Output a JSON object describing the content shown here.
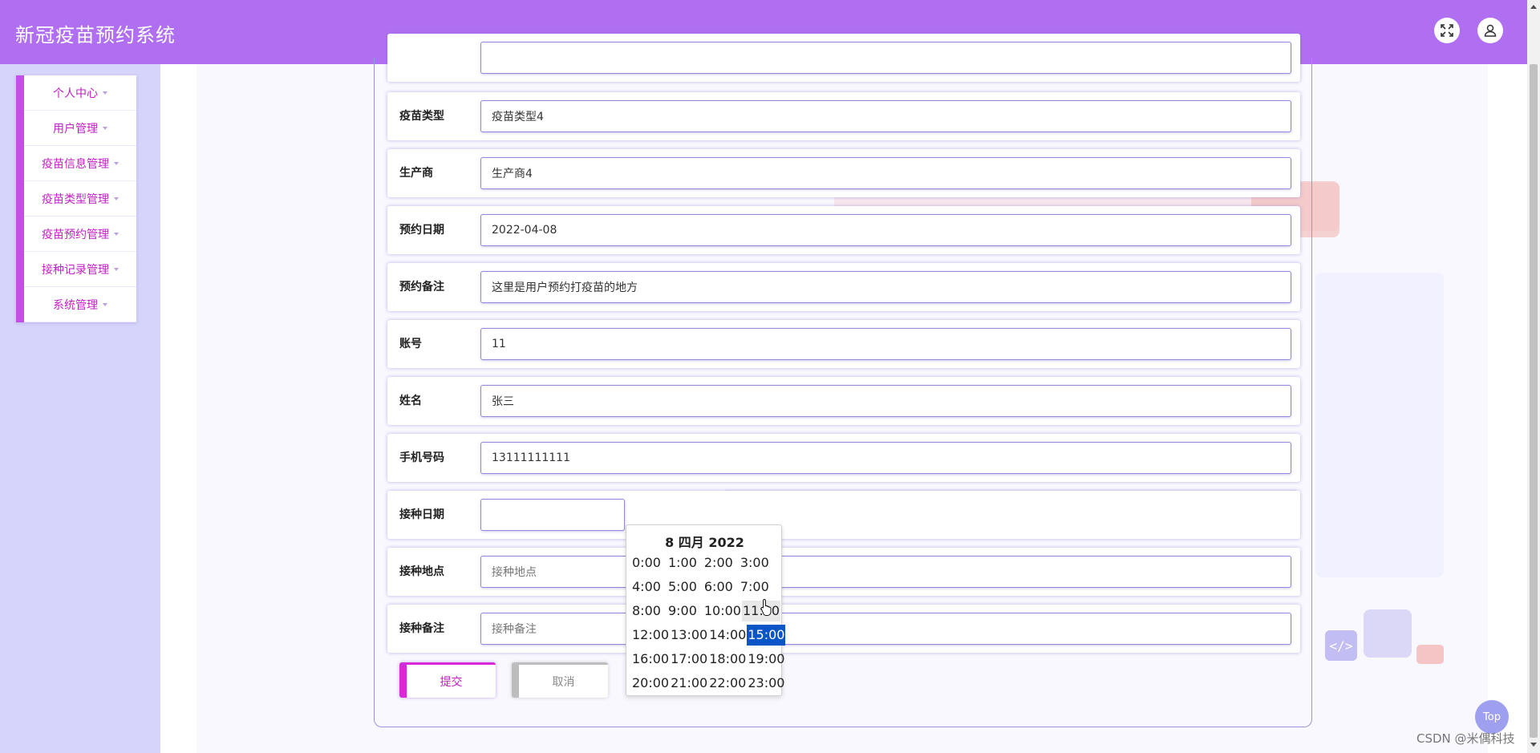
{
  "app": {
    "title": "新冠疫苗预约系统"
  },
  "header": {
    "fullscreen_icon": "fullscreen-icon",
    "user_icon": "user-icon"
  },
  "sidebar": {
    "items": [
      {
        "label": "个人中心"
      },
      {
        "label": "用户管理"
      },
      {
        "label": "疫苗信息管理"
      },
      {
        "label": "疫苗类型管理"
      },
      {
        "label": "疫苗预约管理"
      },
      {
        "label": "接种记录管理"
      },
      {
        "label": "系统管理"
      }
    ]
  },
  "form": {
    "fields": [
      {
        "label": "疫苗类型",
        "value": "疫苗类型4"
      },
      {
        "label": "生产商",
        "value": "生产商4"
      },
      {
        "label": "预约日期",
        "value": "2022-04-08"
      },
      {
        "label": "预约备注",
        "value": "这里是用户预约打疫苗的地方"
      },
      {
        "label": "账号",
        "value": "11"
      },
      {
        "label": "姓名",
        "value": "张三"
      },
      {
        "label": "手机号码",
        "value": "13111111111"
      },
      {
        "label": "接种日期",
        "value": ""
      },
      {
        "label": "接种地点",
        "placeholder": "接种地点"
      },
      {
        "label": "接种备注",
        "placeholder": "接种备注"
      }
    ],
    "submit_label": "提交",
    "cancel_label": "取消"
  },
  "time_picker": {
    "title": "8 四月 2022",
    "times": [
      "0:00",
      "1:00",
      "2:00",
      "3:00",
      "4:00",
      "5:00",
      "6:00",
      "7:00",
      "8:00",
      "9:00",
      "10:00",
      "11:00",
      "12:00",
      "13:00",
      "14:00",
      "15:00",
      "16:00",
      "17:00",
      "18:00",
      "19:00",
      "20:00",
      "21:00",
      "22:00",
      "23:00"
    ],
    "selected": "15:00",
    "hovered": "11:00"
  },
  "footer": {
    "top_label": "Top",
    "watermark": "CSDN @米偶科技",
    "code_badge": "</>"
  },
  "colors": {
    "header": "#b06ef0",
    "accent": "#c24fea",
    "submit": "#d829d8",
    "selected_time": "#0a55c8"
  }
}
